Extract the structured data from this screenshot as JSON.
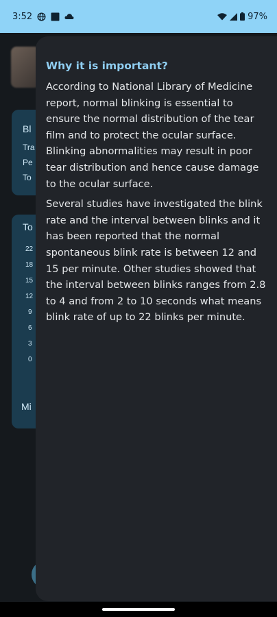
{
  "status_bar": {
    "time": "3:52",
    "battery": "97%",
    "icons": [
      "vpn-globe-icon",
      "square-app-icon",
      "cloud-icon",
      "wifi-icon",
      "signal-icon",
      "battery-icon"
    ]
  },
  "background": {
    "card1": {
      "title": "Bl",
      "lines": [
        "Tra",
        "Pe",
        "To"
      ]
    },
    "card2": {
      "title": "To",
      "ticks": [
        "22",
        "18",
        "15",
        "12",
        "9",
        "6",
        "3",
        "0"
      ],
      "footer": "Mi"
    }
  },
  "drawer": {
    "title": "Why it is important?",
    "paragraphs": [
      "According to National Library of Medicine report, normal blinking is essential to ensure the normal distribution of the tear film and to protect the ocular surface. Blinking abnormalities may result in poor tear distribution and hence cause damage to the ocular surface.",
      "Several studies have investigated the blink rate and the interval between blinks and it has been reported that the normal spontaneous blink rate is between 12 and 15 per minute. Other studies showed that the interval between blinks ranges from 2.8 to 4 and from 2 to 10 seconds what means blink rate of up to 22 blinks per minute."
    ]
  },
  "colors": {
    "status_bar": "#8fd3f7",
    "drawer_bg": "#212429",
    "title": "#8fcdf0",
    "body_text": "#e4e6e8"
  }
}
